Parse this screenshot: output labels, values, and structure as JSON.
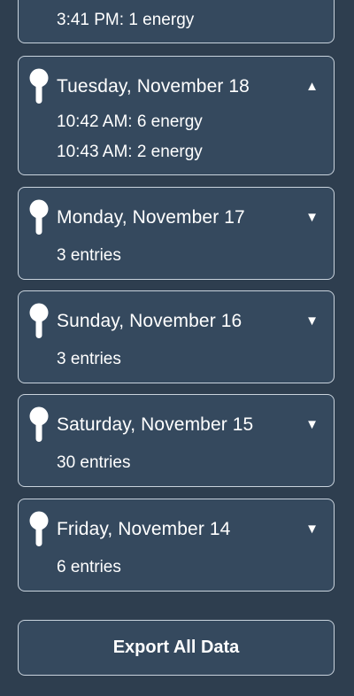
{
  "days": [
    {
      "date": "",
      "expanded": true,
      "lines": [
        "3:41 PM: 1 energy"
      ]
    },
    {
      "date": "Tuesday, November 18",
      "expanded": true,
      "chevron": "▲",
      "lines": [
        "10:42 AM: 6 energy",
        "10:43 AM: 2 energy"
      ]
    },
    {
      "date": "Monday, November 17",
      "expanded": false,
      "chevron": "▼",
      "lines": [
        "3 entries"
      ]
    },
    {
      "date": "Sunday, November 16",
      "expanded": false,
      "chevron": "▼",
      "lines": [
        "3 entries"
      ]
    },
    {
      "date": "Saturday, November 15",
      "expanded": false,
      "chevron": "▼",
      "lines": [
        "30 entries"
      ]
    },
    {
      "date": "Friday, November 14",
      "expanded": false,
      "chevron": "▼",
      "lines": [
        "6 entries"
      ]
    }
  ],
  "export_label": "Export All Data",
  "colors": {
    "background": "#2e3e4f",
    "card": "#35495e",
    "border": "#c9d3dd",
    "text": "#ffffff"
  },
  "icons": {
    "day_icon": "key-icon",
    "expanded": "chevron-up-icon",
    "collapsed": "chevron-down-icon"
  }
}
